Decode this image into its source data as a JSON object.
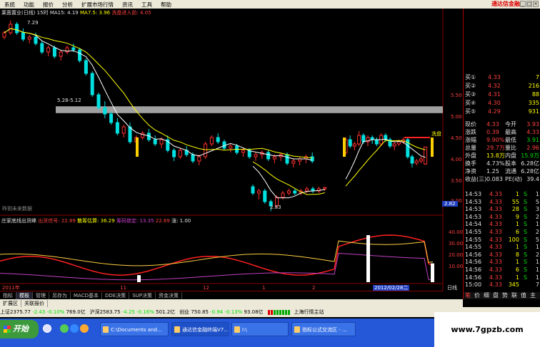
{
  "menu": {
    "items": [
      "系统",
      "功能",
      "报价",
      "分析",
      "扩展市场行情",
      "资讯",
      "工具",
      "帮助"
    ],
    "brand": "通达信金融"
  },
  "main_chart": {
    "header": [
      "莱茵置业(日线) 15时",
      "MA15: 4.19",
      "MA7.5: 3.96",
      "洗盘进入前: 4.05"
    ],
    "high_label": "7.29",
    "gap_label": "5.28-5.12",
    "low_label": "2.83",
    "wash_label": "洗盘",
    "no_data_label": "昨割未来数据",
    "price_axis": [
      "5.50",
      "5.00",
      "4.50",
      "4.00",
      "3.50",
      "3.00"
    ],
    "price_tag": "2.82"
  },
  "indicator": {
    "header": [
      "庄家底线出货峰",
      "出货信号: 22.89",
      "散筹估算: 36.29",
      "筹码锁定: 13.35",
      "22.69",
      "涨: 1.00"
    ],
    "axis": [
      "40.00",
      "30.00",
      "20.00",
      "10.00"
    ]
  },
  "date_axis": {
    "labels": [
      "2011年",
      "11",
      "12",
      "1",
      "2"
    ],
    "cursor_date": "2012/02/28二",
    "right_label": "日线"
  },
  "bottom_tabs": [
    "指标",
    "模板",
    "管理",
    "另存为",
    "MACD基本",
    "DDE决策",
    "SUP决策",
    "资金决策"
  ],
  "extra_tabs": [
    "扩展区",
    "关联报价"
  ],
  "quote_panel": {
    "bids": [
      {
        "label": "买①",
        "price": "4.33",
        "vol": "7"
      },
      {
        "label": "买②",
        "price": "4.32",
        "vol": "216"
      },
      {
        "label": "买③",
        "price": "4.31",
        "vol": "88"
      },
      {
        "label": "买④",
        "price": "4.30",
        "vol": "335"
      },
      {
        "label": "买⑤",
        "price": "4.29",
        "vol": "931"
      }
    ],
    "stats": [
      {
        "k1": "现价",
        "v1": "4.33",
        "k2": "今开",
        "v2": "3.93"
      },
      {
        "k1": "涨跌",
        "v1": "0.39",
        "k2": "最高",
        "v2": "4.33"
      },
      {
        "k1": "涨幅",
        "v1": "9.90%",
        "k2": "最低",
        "v2": "3.91"
      },
      {
        "k1": "总量",
        "v1": "29.7万",
        "k2": "量比",
        "v2": "2.96"
      },
      {
        "k1": "外盘",
        "v1": "13.8万",
        "k2": "内盘",
        "v2": "15.9万"
      },
      {
        "k1": "换手",
        "v1": "4.73%",
        "k2": "股本",
        "v2": "6.28亿"
      },
      {
        "k1": "净资",
        "v1": "1.25",
        "k2": "流通",
        "v2": "6.28亿"
      },
      {
        "k1": "收益(三)",
        "v1": "0.083",
        "k2": "PE(动)",
        "v2": "39.4"
      }
    ],
    "ticks": [
      {
        "time": "14:53",
        "price": "4.33",
        "vol": "1",
        "side": "S",
        "n": "1"
      },
      {
        "time": "14:53",
        "price": "4.33",
        "vol": "55",
        "side": "S",
        "n": "5"
      },
      {
        "time": "14:53",
        "price": "4.33",
        "vol": "28",
        "side": "S",
        "n": "3"
      },
      {
        "time": "14:53",
        "price": "4.33",
        "vol": "9",
        "side": "S",
        "n": "2"
      },
      {
        "time": "14:54",
        "price": "4.33",
        "vol": "1",
        "side": "S",
        "n": "1"
      },
      {
        "time": "14:55",
        "price": "4.33",
        "vol": "6",
        "side": "S",
        "n": "2"
      },
      {
        "time": "14:55",
        "price": "4.33",
        "vol": "100",
        "side": "S",
        "n": "5"
      },
      {
        "time": "14:55",
        "price": "4.33",
        "vol": "1",
        "side": "S",
        "n": "1"
      },
      {
        "time": "14:56",
        "price": "4.33",
        "vol": "8",
        "side": "S",
        "n": "2"
      },
      {
        "time": "14:56",
        "price": "4.33",
        "vol": "1",
        "side": "S",
        "n": "1"
      },
      {
        "time": "14:56",
        "price": "4.33",
        "vol": "6",
        "side": "S",
        "n": "1"
      },
      {
        "time": "14:56",
        "price": "4.33",
        "vol": "1",
        "side": "S",
        "n": "1"
      },
      {
        "time": "15:00",
        "price": "4.33",
        "vol": "345",
        "side": "",
        "n": "7"
      }
    ],
    "tabs": [
      "笔",
      "价",
      "细",
      "盘",
      "势",
      "联",
      "值",
      "主"
    ]
  },
  "status_bar": {
    "sh": "上证2375.77",
    "sh_chg": "-2.43",
    "sh_pct": "-0.10%",
    "sh_amt": "769.0亿",
    "sz": "沪深2583.75",
    "sz_chg": "-4.25",
    "sz_pct": "-0.16%",
    "sz_amt": "501.2亿",
    "cy": "创业 750.85",
    "cy_chg": "-0.94",
    "cy_pct": "-0.13%",
    "cy_amt": "93.08亿",
    "station": "上海行情主站"
  },
  "taskbar": {
    "start": "开始",
    "tasks": [
      "C:\\Documents and...",
      "通达信金融终端V7...",
      "I:\\",
      "指标公式交流区 - ..."
    ]
  },
  "watermark": "www.7gpzb.com",
  "chart_data": {
    "type": "candlestick",
    "title": "莱茵置业(日线)",
    "ylim": [
      2.8,
      7.4
    ],
    "candles": [
      [
        6.9,
        7.05,
        6.85,
        7.0
      ],
      [
        7.0,
        7.29,
        6.95,
        7.2
      ],
      [
        7.2,
        7.25,
        6.95,
        7.0
      ],
      [
        7.0,
        7.1,
        6.8,
        6.85
      ],
      [
        6.85,
        6.95,
        6.75,
        6.9
      ],
      [
        6.9,
        7.0,
        6.7,
        6.75
      ],
      [
        6.75,
        6.8,
        6.5,
        6.55
      ],
      [
        6.55,
        6.7,
        6.45,
        6.65
      ],
      [
        6.65,
        6.7,
        6.4,
        6.45
      ],
      [
        6.45,
        6.6,
        6.35,
        6.55
      ],
      [
        6.55,
        6.7,
        6.5,
        6.65
      ],
      [
        6.65,
        6.75,
        6.55,
        6.6
      ],
      [
        6.6,
        6.65,
        6.3,
        6.35
      ],
      [
        6.35,
        6.4,
        6.0,
        6.05
      ],
      [
        6.05,
        6.1,
        5.5,
        5.55
      ],
      [
        5.55,
        5.6,
        5.2,
        5.25
      ],
      [
        5.25,
        5.4,
        5.0,
        5.1
      ],
      [
        5.1,
        5.15,
        4.85,
        4.9
      ],
      [
        4.9,
        5.0,
        4.6,
        4.65
      ],
      [
        4.65,
        4.85,
        4.55,
        4.8
      ],
      [
        4.8,
        4.9,
        4.4,
        4.45
      ],
      [
        4.45,
        4.6,
        4.3,
        4.55
      ],
      [
        4.55,
        4.7,
        4.5,
        4.65
      ],
      [
        4.65,
        4.75,
        4.45,
        4.5
      ],
      [
        4.5,
        4.6,
        4.35,
        4.4
      ],
      [
        4.4,
        4.55,
        4.3,
        4.5
      ],
      [
        4.5,
        4.6,
        4.2,
        4.25
      ],
      [
        4.25,
        4.3,
        4.0,
        4.1
      ],
      [
        4.1,
        4.3,
        4.05,
        4.25
      ],
      [
        4.25,
        4.35,
        4.1,
        4.15
      ],
      [
        4.15,
        4.2,
        3.95,
        4.0
      ],
      [
        4.0,
        4.15,
        3.9,
        4.1
      ],
      [
        4.1,
        4.45,
        4.05,
        4.4
      ],
      [
        4.4,
        4.6,
        4.35,
        4.55
      ],
      [
        4.55,
        4.65,
        4.4,
        4.45
      ],
      [
        4.45,
        4.5,
        4.25,
        4.3
      ],
      [
        4.3,
        4.4,
        4.2,
        4.35
      ],
      [
        4.35,
        4.4,
        4.15,
        4.2
      ],
      [
        4.2,
        4.3,
        4.1,
        4.25
      ],
      [
        4.25,
        4.3,
        4.05,
        4.1
      ],
      [
        4.1,
        4.2,
        4.0,
        4.15
      ],
      [
        4.15,
        4.25,
        4.05,
        4.2
      ],
      [
        4.2,
        4.25,
        4.0,
        4.05
      ],
      [
        4.05,
        4.15,
        3.95,
        4.1
      ],
      [
        4.1,
        4.2,
        4.0,
        4.15
      ],
      [
        4.15,
        4.2,
        3.9,
        3.95
      ],
      [
        3.95,
        4.05,
        3.85,
        4.0
      ],
      [
        4.0,
        4.1,
        3.9,
        4.05
      ],
      [
        4.05,
        4.15,
        3.95,
        4.1
      ],
      [
        4.1,
        4.2,
        3.95,
        4.0
      ],
      [
        3.4,
        3.45,
        3.2,
        3.25
      ],
      [
        3.25,
        3.35,
        3.1,
        3.3
      ],
      [
        3.3,
        3.35,
        3.0,
        3.05
      ],
      [
        3.05,
        3.1,
        2.83,
        2.95
      ],
      [
        2.95,
        3.2,
        2.9,
        3.15
      ],
      [
        3.15,
        3.3,
        3.1,
        3.25
      ],
      [
        3.25,
        3.35,
        3.2,
        3.3
      ],
      [
        3.3,
        3.35,
        3.2,
        3.25
      ],
      [
        3.25,
        3.35,
        3.2,
        3.3
      ],
      [
        3.3,
        3.4,
        3.25,
        3.35
      ],
      [
        3.35,
        3.4,
        3.25,
        3.3
      ],
      [
        3.3,
        3.4,
        3.25,
        3.35
      ],
      [
        3.35,
        3.4,
        3.3,
        3.38
      ],
      [
        4.2,
        4.55,
        4.15,
        4.5
      ],
      [
        4.5,
        4.6,
        4.3,
        4.35
      ],
      [
        4.35,
        4.45,
        4.25,
        4.4
      ],
      [
        4.4,
        4.7,
        4.35,
        4.6
      ],
      [
        4.6,
        4.65,
        4.4,
        4.45
      ],
      [
        4.45,
        4.6,
        4.35,
        4.55
      ],
      [
        4.55,
        4.6,
        4.4,
        4.5
      ],
      [
        4.5,
        4.55,
        4.35,
        4.4
      ],
      [
        4.4,
        4.65,
        4.35,
        4.6
      ],
      [
        4.6,
        4.65,
        4.45,
        4.5
      ],
      [
        4.5,
        4.55,
        4.3,
        4.35
      ],
      [
        4.35,
        4.45,
        4.25,
        4.4
      ],
      [
        4.4,
        4.5,
        4.35,
        4.45
      ],
      [
        4.45,
        4.55,
        4.4,
        4.5
      ],
      [
        4.5,
        4.55,
        4.05,
        4.1
      ],
      [
        4.1,
        4.15,
        3.85,
        3.95
      ],
      [
        3.95,
        4.05,
        3.9,
        4.0
      ],
      [
        4.0,
        4.1,
        3.95,
        4.05
      ],
      [
        3.93,
        4.33,
        3.91,
        4.33
      ]
    ]
  }
}
